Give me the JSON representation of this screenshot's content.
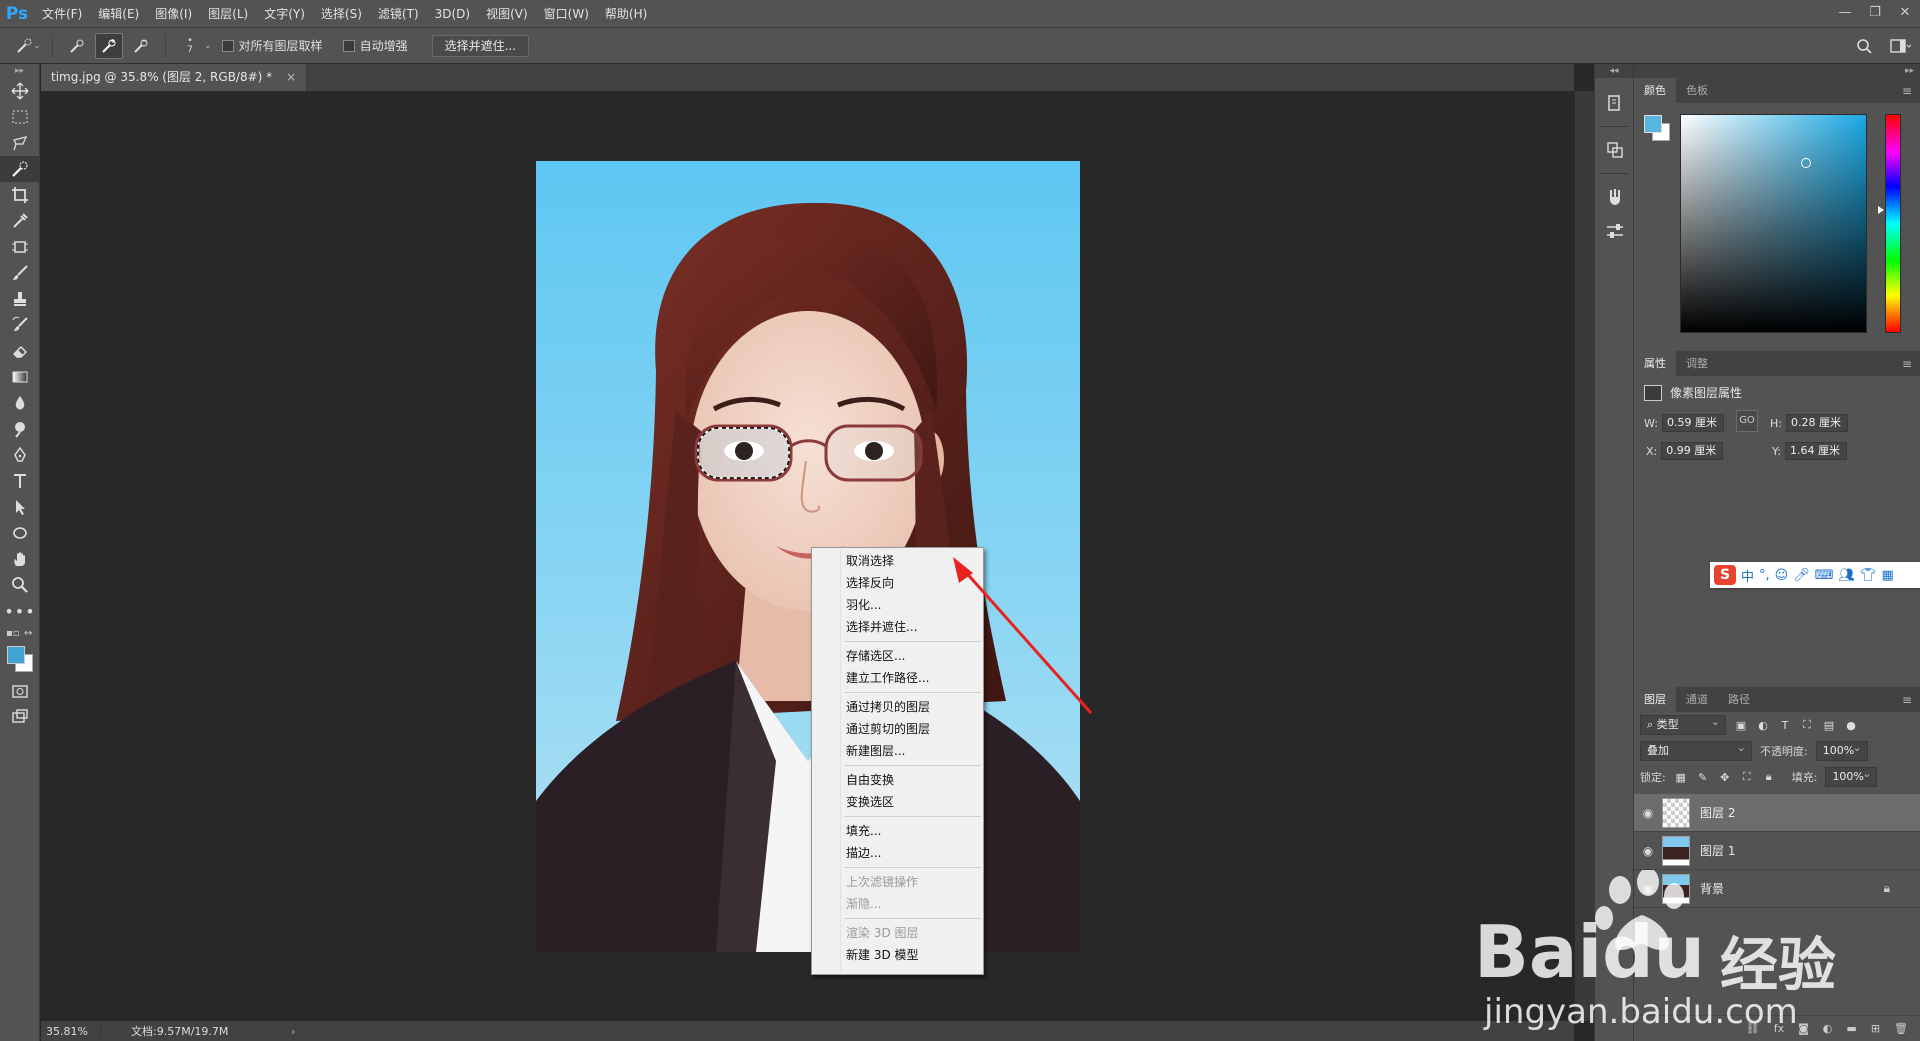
{
  "app": {
    "logo": "Ps"
  },
  "menu": {
    "items": [
      "文件(F)",
      "编辑(E)",
      "图像(I)",
      "图层(L)",
      "文字(Y)",
      "选择(S)",
      "滤镜(T)",
      "3D(D)",
      "视图(V)",
      "窗口(W)",
      "帮助(H)"
    ]
  },
  "window_controls": {
    "minimize": "—",
    "restore": "❐",
    "close": "✕"
  },
  "options": {
    "brush_size": "7",
    "sample_all_layers": "对所有图层取样",
    "auto_enhance": "自动增强",
    "select_mask_button": "选择并遮住..."
  },
  "document": {
    "tab_title": "timg.jpg @ 35.8% (图层 2, RGB/8#) *",
    "tab_close": "×"
  },
  "status": {
    "zoom": "35.81%",
    "doc_size": "文档:9.57M/19.7M",
    "arrow": "›"
  },
  "context_menu": {
    "groups": [
      [
        {
          "label": "取消选择",
          "disabled": false
        },
        {
          "label": "选择反向",
          "disabled": false
        },
        {
          "label": "羽化...",
          "disabled": false
        },
        {
          "label": "选择并遮住...",
          "disabled": false
        }
      ],
      [
        {
          "label": "存储选区...",
          "disabled": false
        },
        {
          "label": "建立工作路径...",
          "disabled": false
        }
      ],
      [
        {
          "label": "通过拷贝的图层",
          "disabled": false
        },
        {
          "label": "通过剪切的图层",
          "disabled": false
        },
        {
          "label": "新建图层...",
          "disabled": false
        }
      ],
      [
        {
          "label": "自由变换",
          "disabled": false
        },
        {
          "label": "变换选区",
          "disabled": false
        }
      ],
      [
        {
          "label": "填充...",
          "disabled": false
        },
        {
          "label": "描边...",
          "disabled": false
        }
      ],
      [
        {
          "label": "上次滤镜操作",
          "disabled": true
        },
        {
          "label": "渐隐...",
          "disabled": true
        }
      ],
      [
        {
          "label": "渲染 3D 图层",
          "disabled": true
        },
        {
          "label": "新建 3D 模型",
          "disabled": false
        }
      ]
    ]
  },
  "panels": {
    "color_tabs": [
      "颜色",
      "色板"
    ],
    "props_tabs": [
      "属性",
      "调整"
    ],
    "props_title": "像素图层属性",
    "props": {
      "w_label": "W:",
      "w": "0.59 厘米",
      "h_label": "H:",
      "h": "0.28 厘米",
      "x_label": "X:",
      "x": "0.99 厘米",
      "y_label": "Y:",
      "y": "1.64 厘米",
      "link": "GO"
    },
    "layers_tabs": [
      "图层",
      "通道",
      "路径"
    ],
    "layers": {
      "filter": "类型",
      "blend_mode": "叠加",
      "opacity_label": "不透明度:",
      "opacity": "100%",
      "lock_label": "锁定:",
      "fill_label": "填充:",
      "fill": "100%",
      "items": [
        {
          "name": "图层 2",
          "selected": true,
          "locked": false
        },
        {
          "name": "图层 1",
          "selected": false,
          "locked": false
        },
        {
          "name": "背景",
          "selected": false,
          "locked": true
        }
      ]
    }
  },
  "ime": {
    "logo": "S",
    "mode": "中"
  },
  "watermark": {
    "brand": "Baidu",
    "cn": "经验",
    "url": "jingyan.baidu.com"
  },
  "colors": {
    "foreground": "#3fa4d4",
    "background": "#ffffff",
    "accent": "#31a8ff",
    "annotation": "#e8231d"
  }
}
